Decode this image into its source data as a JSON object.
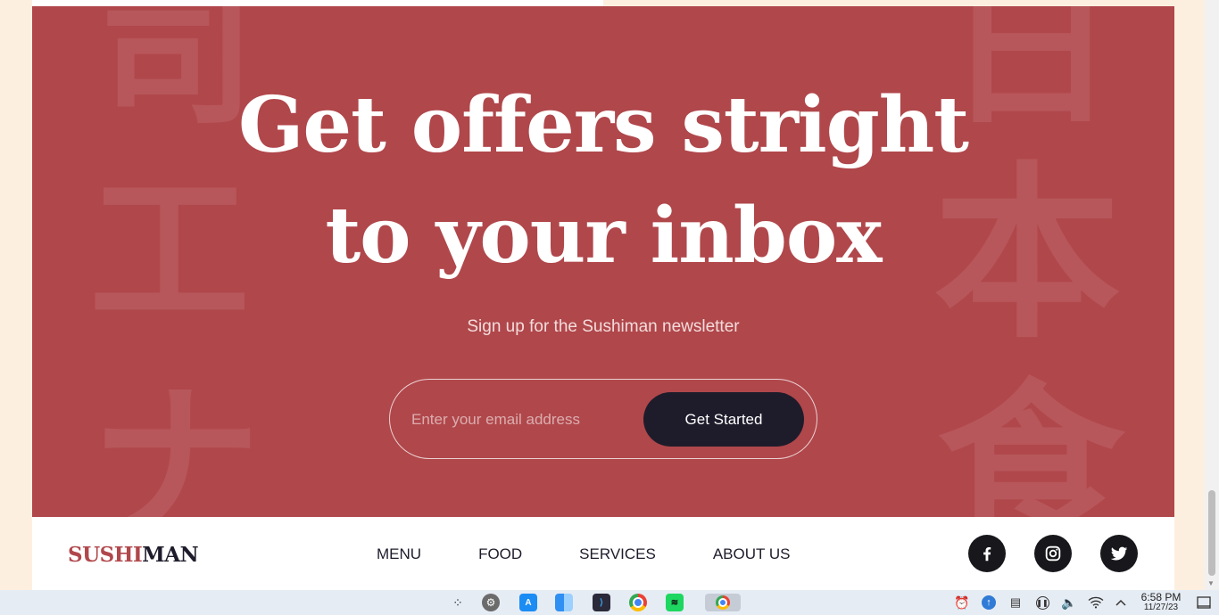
{
  "hero": {
    "headline_line1": "Get offers stright",
    "headline_line2": "to your inbox",
    "subtitle": "Sign up for the Sushiman newsletter",
    "email_placeholder": "Enter your email address",
    "cta_label": "Get Started",
    "background_kanji_left": [
      "司",
      "工",
      "ナ"
    ],
    "background_kanji_right": [
      "日",
      "本",
      "食"
    ]
  },
  "footer": {
    "logo_part1": "SUSHI",
    "logo_part2": "MAN",
    "nav": [
      "MENU",
      "FOOD",
      "SERVICES",
      "ABOUT US"
    ],
    "social": [
      "facebook-icon",
      "instagram-icon",
      "twitter-icon"
    ]
  },
  "taskbar": {
    "apps": [
      "launcher-icon",
      "system-settings-icon",
      "app-store-icon",
      "finder-icon",
      "vscode-icon",
      "chrome-icon",
      "spotify-icon",
      "chrome-active-icon"
    ],
    "tray": [
      "alarm-icon",
      "update-icon",
      "clipboard-icon",
      "pause-icon",
      "volume-icon",
      "wifi-icon",
      "chevron-up-icon"
    ],
    "time": "6:58 PM",
    "date": "11/27/23"
  },
  "colors": {
    "brand_red": "#b0474b",
    "dark": "#1e1c2b",
    "page_bg": "#fdefe0"
  }
}
